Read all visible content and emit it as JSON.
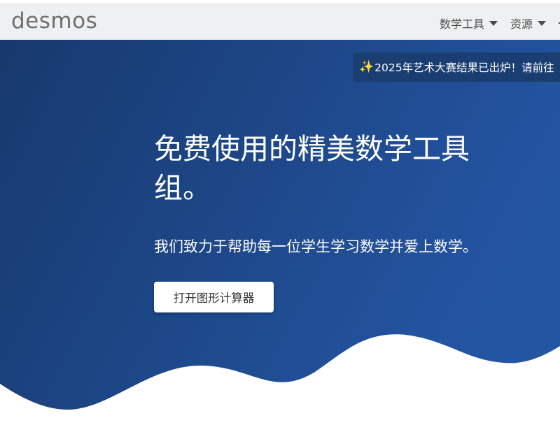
{
  "header": {
    "logo": "desmos",
    "nav": [
      {
        "label": "数学工具"
      },
      {
        "label": "资源"
      }
    ]
  },
  "announcement": {
    "icon": "sparkles-icon",
    "text": "2025年艺术大赛结果已出炉！请前往"
  },
  "hero": {
    "headline": "免费使用的精美数学工具组。",
    "subheading": "我们致力于帮助每一位学生学习数学并爱上数学。",
    "cta_label": "打开图形计算器"
  },
  "colors": {
    "hero_gradient_start": "#17396d",
    "hero_gradient_end": "#2455a3",
    "announcement_bg": "#1a3e72",
    "topbar_bg": "#eef0f1",
    "sparkle": "#f3c93a"
  }
}
